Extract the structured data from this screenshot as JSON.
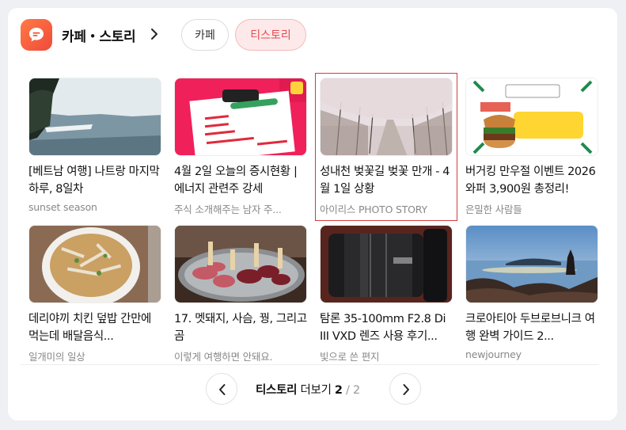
{
  "header": {
    "title": "카페・스토리",
    "tabs": [
      {
        "label": "카페",
        "active": false
      },
      {
        "label": "티스토리",
        "active": true
      }
    ]
  },
  "colors": {
    "accent": "#e8494d",
    "logo": "#f0553a",
    "selected_outline": "#d23c3c"
  },
  "items": [
    {
      "title": "[베트남 여행] 나트랑 마지막 하루, 8일차",
      "source": "sunset season",
      "thumb": "lake-landscape"
    },
    {
      "title": "4월 2일 오늘의 증시현황 | 에너지 관련주 강세",
      "source": "주식 소개해주는 남자 주...",
      "thumb": "stock-clipboard"
    },
    {
      "title": "성내천 벚꽃길 벚꽃 만개 - 4월 1일 상황",
      "source": "아이리스 PHOTO STORY",
      "thumb": "cherry-blossom-road",
      "selected": true
    },
    {
      "title": "버거킹 만우절 이벤트 2026와퍼 3,900원 총정리!",
      "source": "은밀한 사람들",
      "thumb": "burger-promo"
    },
    {
      "title": "데리야끼 치킨 덮밥 간만에 먹는데 배달음식...",
      "source": "일개미의 일상",
      "thumb": "chicken-bowl"
    },
    {
      "title": "17. 멧돼지, 사슴, 꿩, 그리고 곰",
      "source": "이렇게 여행하면 안돼요.",
      "thumb": "meat-platter"
    },
    {
      "title": "탐론 35-100mm F2.8 Di III VXD 렌즈 사용 후기...",
      "source": "빛으로 쓴 편지",
      "thumb": "camera-lens"
    },
    {
      "title": "크로아티아 두브로브니크 여행 완벽 가이드 2...",
      "source": "newjourney",
      "thumb": "coast-sunset"
    }
  ],
  "pager": {
    "label": "티스토리",
    "more": "더보기",
    "current": "2",
    "separator": "/",
    "total": "2"
  },
  "icons": {
    "logo": "speech-bubble-icon",
    "title_arrow": "chevron-right-icon",
    "prev": "chevron-left-icon",
    "next": "chevron-right-icon"
  }
}
